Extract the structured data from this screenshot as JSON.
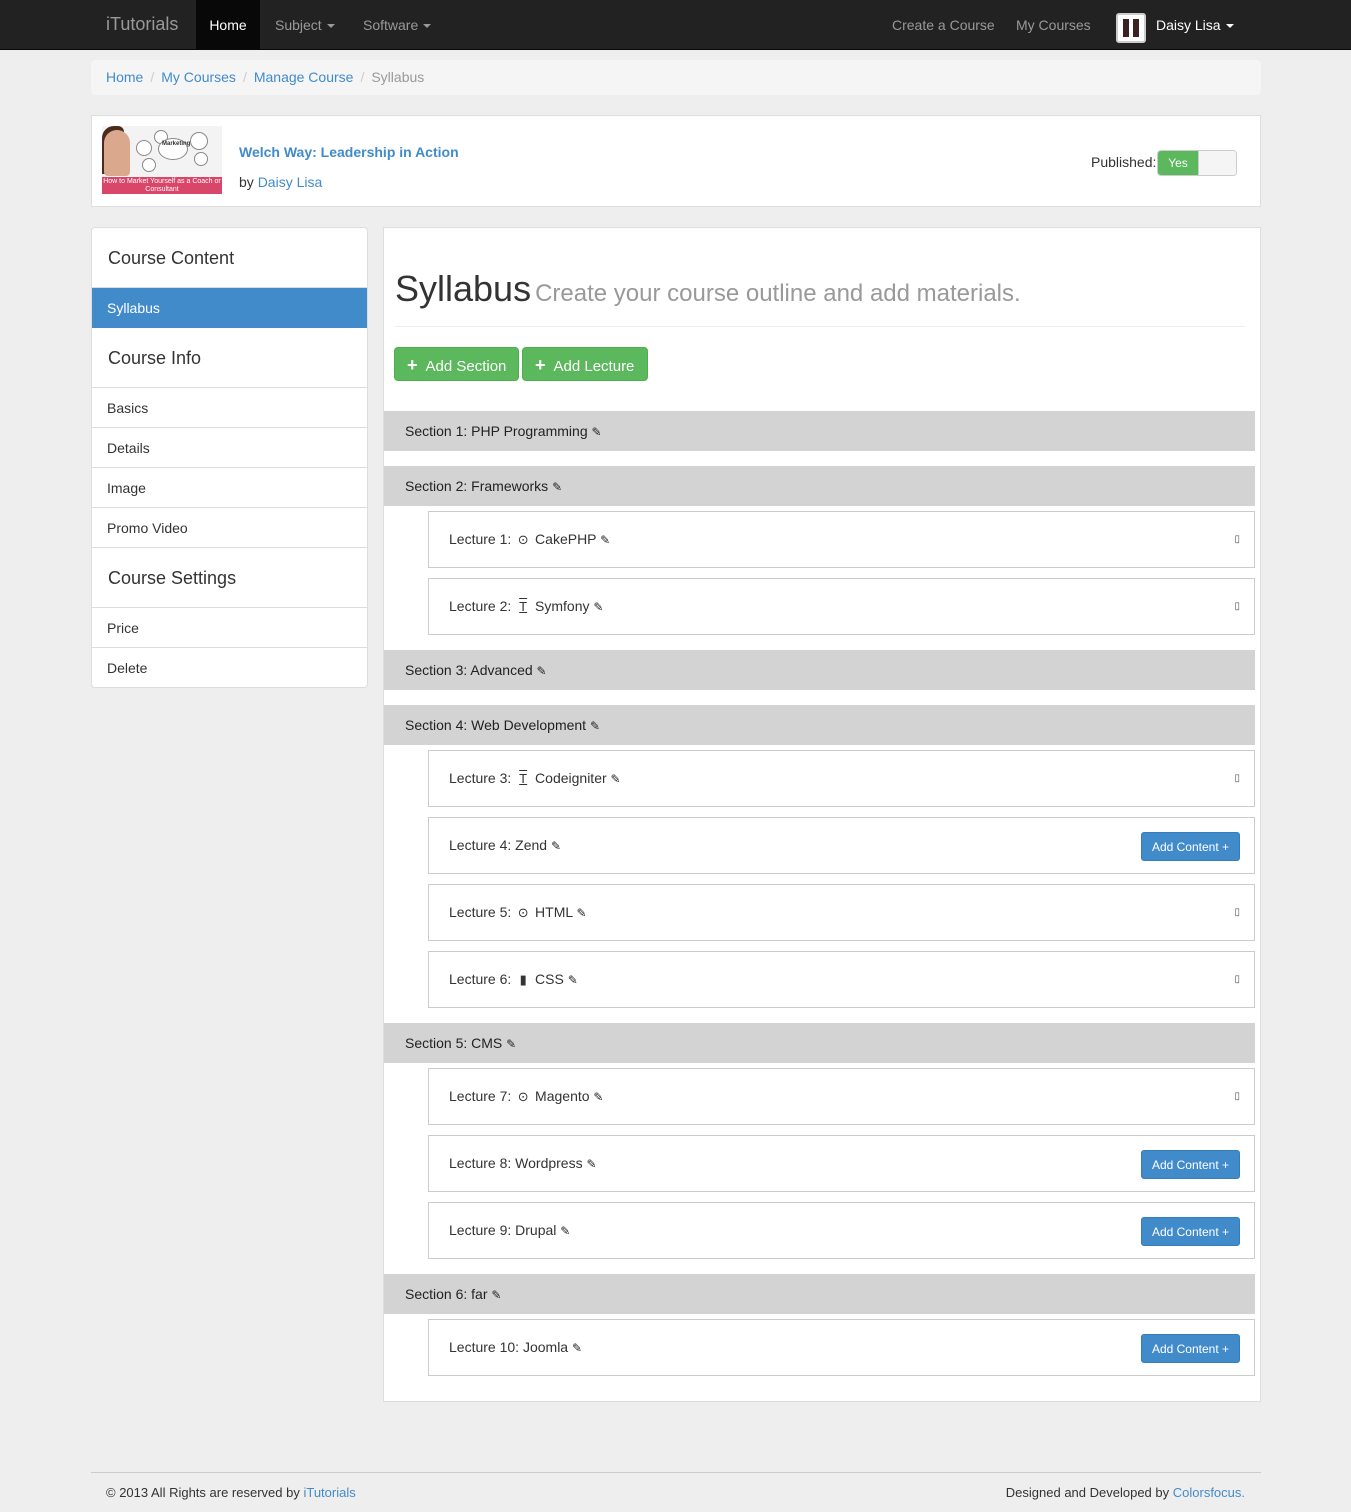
{
  "navbar": {
    "brand": "iTutorials",
    "home": "Home",
    "subject": "Subject",
    "software": "Software",
    "create_course": "Create a Course",
    "my_courses": "My Courses",
    "user": "Daisy Lisa"
  },
  "breadcrumb": {
    "home": "Home",
    "my_courses": "My Courses",
    "manage_course": "Manage Course",
    "current": "Syllabus"
  },
  "course": {
    "title": "Welch Way: Leadership in Action",
    "by_label": "by",
    "author": "Daisy Lisa",
    "published_label": "Published:",
    "published_value": "Yes",
    "thumb_band": "How to Market Yourself as a Coach or Consultant",
    "thumb_word": "Marketing"
  },
  "sidebar": {
    "course_content": "Course Content",
    "syllabus": "Syllabus",
    "course_info": "Course Info",
    "basics": "Basics",
    "details": "Details",
    "image": "Image",
    "promo_video": "Promo Video",
    "course_settings": "Course Settings",
    "price": "Price",
    "delete": "Delete"
  },
  "main": {
    "title": "Syllabus",
    "subtitle": "Create your course outline and add materials.",
    "add_section": "Add Section",
    "add_lecture": "Add Lecture",
    "add_content_label": "Add Content +"
  },
  "sections": [
    {
      "label": "Section 1: PHP Programming"
    },
    {
      "label": "Section 2: Frameworks"
    },
    {
      "label": "Section 3: Advanced"
    },
    {
      "label": "Section 4: Web Development"
    },
    {
      "label": "Section 5: CMS"
    },
    {
      "label": "Section 6: far"
    }
  ],
  "lectures": [
    {
      "prefix": "Lecture 1:",
      "name": "CakePHP",
      "type_icon": "video-icon",
      "glyph": "⊙",
      "has_content": true
    },
    {
      "prefix": "Lecture 2:",
      "name": "Symfony",
      "type_icon": "text-icon",
      "glyph": "T",
      "has_content": true
    },
    {
      "prefix": "Lecture 3:",
      "name": "Codeigniter",
      "type_icon": "text-icon",
      "glyph": "T",
      "has_content": true
    },
    {
      "prefix": "Lecture 4:",
      "name": "Zend",
      "type_icon": "",
      "glyph": "",
      "has_content": false
    },
    {
      "prefix": "Lecture 5:",
      "name": "HTML",
      "type_icon": "video-icon",
      "glyph": "⊙",
      "has_content": true
    },
    {
      "prefix": "Lecture 6:",
      "name": "CSS",
      "type_icon": "file-icon",
      "glyph": "▮",
      "has_content": true
    },
    {
      "prefix": "Lecture 7:",
      "name": "Magento",
      "type_icon": "video-icon",
      "glyph": "⊙",
      "has_content": true
    },
    {
      "prefix": "Lecture 8:",
      "name": "Wordpress",
      "type_icon": "",
      "glyph": "",
      "has_content": false
    },
    {
      "prefix": "Lecture 9:",
      "name": "Drupal",
      "type_icon": "",
      "glyph": "",
      "has_content": false
    },
    {
      "prefix": "Lecture 10:",
      "name": "Joomla",
      "type_icon": "",
      "glyph": "",
      "has_content": false
    }
  ],
  "footer": {
    "left_text": "© 2013 All Rights are reserved by",
    "left_link": "iTutorials",
    "right_text": "Designed and Developed by",
    "right_link": "Colorsfocus."
  },
  "colors": {
    "navbar_bg": "#222222",
    "link": "#428bca",
    "active_sidebar": "#428bca",
    "success": "#5cb85c",
    "section_bar": "#d3d3d3",
    "page_bg": "#eeeeee"
  }
}
